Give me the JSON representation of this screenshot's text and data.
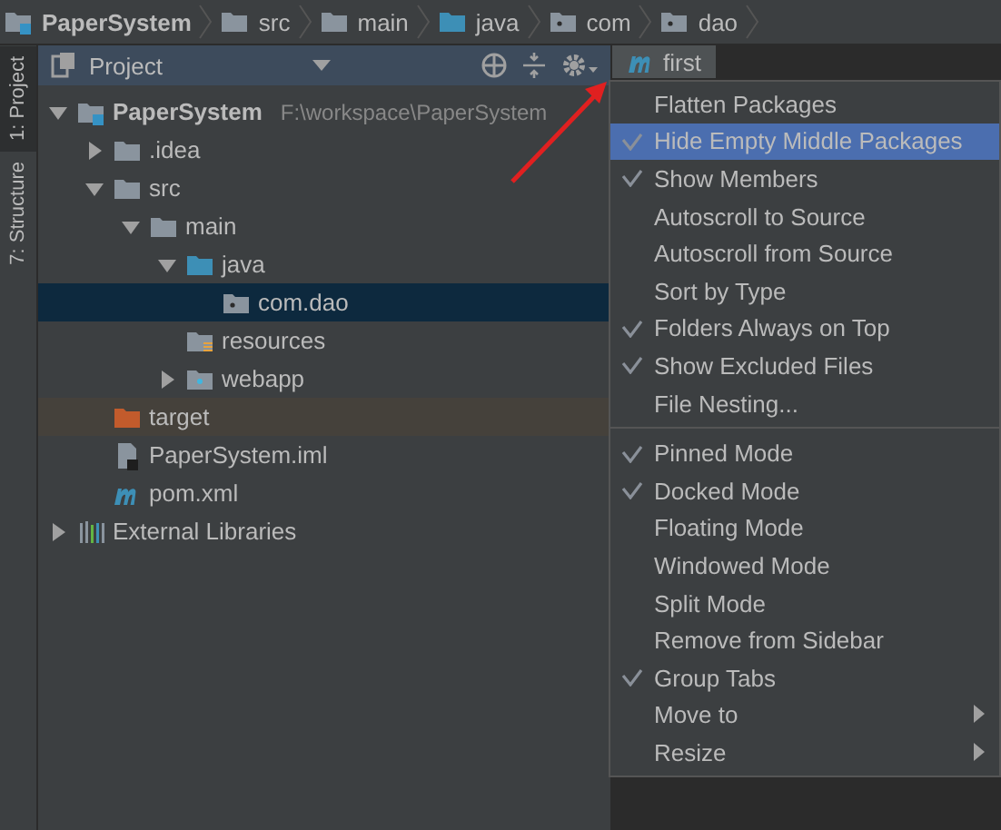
{
  "breadcrumbs": [
    {
      "label": "PaperSystem",
      "kind": "module"
    },
    {
      "label": "src",
      "kind": "folder"
    },
    {
      "label": "main",
      "kind": "folder"
    },
    {
      "label": "java",
      "kind": "source"
    },
    {
      "label": "com",
      "kind": "package"
    },
    {
      "label": "dao",
      "kind": "package"
    }
  ],
  "tool_strip": [
    {
      "label": "1: Project",
      "selected": true
    },
    {
      "label": "7: Structure",
      "selected": false
    }
  ],
  "project_panel": {
    "title": "Project"
  },
  "tree": [
    {
      "label": "PaperSystem",
      "path": "F:\\workspace\\PaperSystem",
      "kind": "module",
      "expanded": true,
      "selected": false,
      "children": [
        {
          "label": ".idea",
          "kind": "folder",
          "expanded": false,
          "selected": false
        },
        {
          "label": "src",
          "kind": "folder",
          "expanded": true,
          "selected": false,
          "children": [
            {
              "label": "main",
              "kind": "folder",
              "expanded": true,
              "selected": false,
              "children": [
                {
                  "label": "java",
                  "kind": "source",
                  "expanded": true,
                  "selected": false,
                  "children": [
                    {
                      "label": "com.dao",
                      "kind": "package",
                      "selected": true
                    }
                  ]
                },
                {
                  "label": "resources",
                  "kind": "resources",
                  "selected": false
                },
                {
                  "label": "webapp",
                  "kind": "web",
                  "expanded": false,
                  "selected": false
                }
              ]
            }
          ]
        },
        {
          "label": "target",
          "kind": "excluded",
          "selected": false
        },
        {
          "label": "PaperSystem.iml",
          "kind": "iml",
          "selected": false
        },
        {
          "label": "pom.xml",
          "kind": "maven",
          "selected": false
        }
      ]
    },
    {
      "label": "External Libraries",
      "kind": "libraries",
      "expanded": false,
      "selected": false
    }
  ],
  "editor_tab": {
    "label": "first"
  },
  "menu": {
    "groups": [
      [
        {
          "label": "Flatten Packages",
          "checked": false,
          "selected": false
        },
        {
          "label": "Hide Empty Middle Packages",
          "checked": true,
          "selected": true
        },
        {
          "label": "Show Members",
          "checked": true,
          "selected": false
        },
        {
          "label": "Autoscroll to Source",
          "checked": false,
          "selected": false
        },
        {
          "label": "Autoscroll from Source",
          "checked": false,
          "selected": false
        },
        {
          "label": "Sort by Type",
          "checked": false,
          "selected": false
        },
        {
          "label": "Folders Always on Top",
          "checked": true,
          "selected": false
        },
        {
          "label": "Show Excluded Files",
          "checked": true,
          "selected": false
        },
        {
          "label": "File Nesting...",
          "checked": false,
          "selected": false
        }
      ],
      [
        {
          "label": "Pinned Mode",
          "checked": true,
          "selected": false
        },
        {
          "label": "Docked Mode",
          "checked": true,
          "selected": false
        },
        {
          "label": "Floating Mode",
          "checked": false,
          "selected": false
        },
        {
          "label": "Windowed Mode",
          "checked": false,
          "selected": false
        },
        {
          "label": "Split Mode",
          "checked": false,
          "selected": false
        },
        {
          "label": "Remove from Sidebar",
          "checked": false,
          "selected": false
        },
        {
          "label": "Group Tabs",
          "checked": true,
          "selected": false
        },
        {
          "label": "Move to",
          "checked": false,
          "selected": false,
          "submenu": true
        },
        {
          "label": "Resize",
          "checked": false,
          "selected": false,
          "submenu": true
        }
      ]
    ]
  }
}
